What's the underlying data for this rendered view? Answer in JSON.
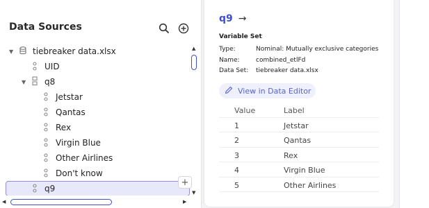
{
  "data_sources": {
    "title": "Data Sources",
    "tree": [
      {
        "label": "tiebreaker data.xlsx",
        "icon": "database-icon",
        "chevron": "▼"
      },
      {
        "label": "UID",
        "icon": "variable-icon"
      },
      {
        "label": "q8",
        "icon": "variable-set-icon",
        "chevron": "▼"
      },
      {
        "label": "Jetstar",
        "icon": "variable-icon"
      },
      {
        "label": "Qantas",
        "icon": "variable-icon"
      },
      {
        "label": "Rex",
        "icon": "variable-icon"
      },
      {
        "label": "Virgin Blue",
        "icon": "variable-icon"
      },
      {
        "label": "Other Airlines",
        "icon": "variable-icon"
      },
      {
        "label": "Don't know",
        "icon": "variable-icon"
      },
      {
        "label": "q9",
        "icon": "variable-icon",
        "selected": true
      }
    ],
    "add_label": "+"
  },
  "variable": {
    "name": "q9",
    "arrow": "→",
    "section": "Variable Set",
    "type_label": "Type:",
    "type_value": "Nominal: Mutually exclusive categories",
    "name_label": "Name:",
    "name_value": "combined_etlFd",
    "dataset_label": "Data Set:",
    "dataset_value": "tiebreaker data.xlsx",
    "edit_label": "View in Data Editor",
    "table": {
      "headers": [
        "Value",
        "Label"
      ],
      "rows": [
        [
          "1",
          "Jetstar"
        ],
        [
          "2",
          "Qantas"
        ],
        [
          "3",
          "Rex"
        ],
        [
          "4",
          "Virgin Blue"
        ],
        [
          "5",
          "Other Airlines"
        ]
      ]
    }
  },
  "colors": {
    "accent": "#3d4fd0",
    "selected_bg": "#e8e8fb"
  }
}
